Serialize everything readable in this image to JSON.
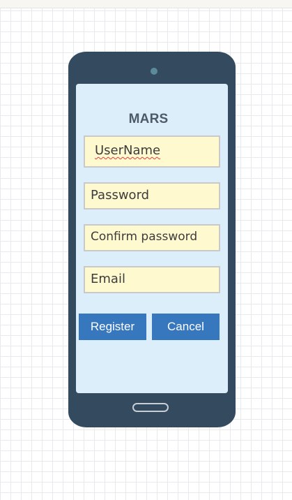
{
  "app": {
    "title": "MARS"
  },
  "form": {
    "username_value": "UserName",
    "password_placeholder": "Password",
    "confirm_password_placeholder": "Confirm password",
    "email_placeholder": "Email"
  },
  "buttons": {
    "register_label": "Register",
    "cancel_label": "Cancel"
  },
  "colors": {
    "phone_body": "#344a5f",
    "screen": "#dbeef9",
    "field_bg": "#fff9cf",
    "button": "#3677bd"
  }
}
